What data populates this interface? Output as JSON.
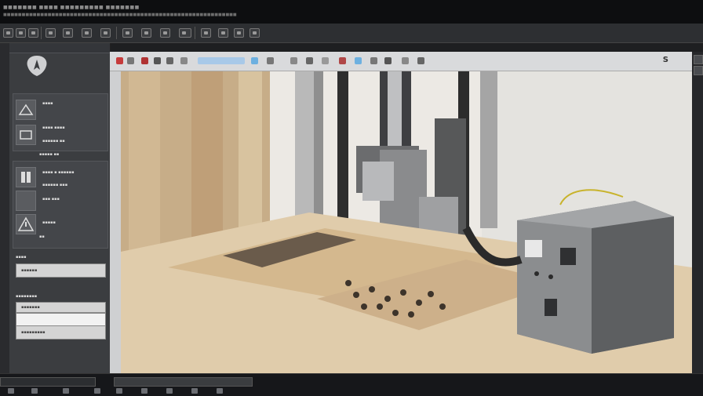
{
  "app": {
    "title_line1": "■■■■■■■ ■■■■ ■■■■■■■■■ ■■■■■■■",
    "title_line2": "■■■■■■■■■■■■■■■■■■■■■■■■■■■■■■■■■■■■■■■■■■■■■■■■■■■■■■■■■■■■■■■"
  },
  "left_panel": {
    "tools": [
      {
        "label": "▪▪▪▪",
        "icon": "router-tool-icon"
      },
      {
        "label": "▪▪▪▪ ▪▪▪▪",
        "icon": "drill-tool-icon"
      },
      {
        "label": "▪▪▪▪▪▪ ▪▪",
        "icon": "profile-tool-icon"
      }
    ],
    "section_label": "▪▪▪▪▪ ▪▪",
    "ops": [
      {
        "label": "▪▪▪▪ ▪ ▪▪▪▪▪▪",
        "icon": "pocket-op-icon"
      },
      {
        "label": "▪▪▪▪▪▪ ▪▪▪",
        "icon": "chamfer-op-icon"
      },
      {
        "label": "▪▪▪ ▪▪▪",
        "icon": "engrave-op-icon"
      },
      {
        "label": "▪▪▪▪▪",
        "icon": "warning-op-icon"
      },
      {
        "label": "▪▪",
        "icon": "none"
      }
    ],
    "field_group_1_label": "▪▪▪▪",
    "field_1_value": "▪▪▪▪▪▪",
    "field_group_2_label": "▪▪▪▪▪▪▪▪",
    "field_2_value": "▪▪▪▪▪▪▪",
    "field_3_value": "▪▪▪▪▪▪▪▪▪"
  },
  "viewport": {
    "label": "S"
  },
  "colors": {
    "accent": "#e14a4a",
    "panel": "#3b3d40",
    "viewport_bg": "#f4f1ea"
  }
}
